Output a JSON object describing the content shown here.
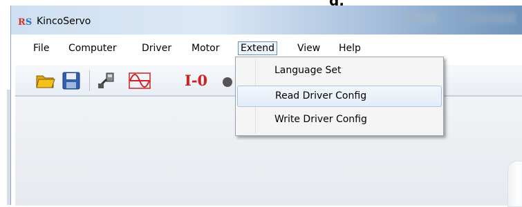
{
  "window": {
    "title": "KincoServo",
    "icon_letters": [
      "R",
      "S"
    ]
  },
  "menubar": {
    "items": [
      "File",
      "Computer",
      "Driver",
      "Motor",
      "Extend",
      "View",
      "Help"
    ],
    "active": "Extend"
  },
  "toolbar": {
    "buttons": [
      "open-folder-icon",
      "save-disk-icon",
      "connect-icon",
      "oscilloscope-icon",
      "io-icon",
      "settings-icon"
    ],
    "io_label": "I-0"
  },
  "extend_menu": {
    "items": [
      "Language Set",
      "Read Driver Config",
      "Write Driver Config"
    ],
    "hovered": "Read Driver Config"
  },
  "colors": {
    "menu_highlight_border": "#6b8fb3",
    "hover_fill": "#e3ecf7",
    "io_red": "#d21f1f",
    "folder_yellow": "#f3c21b",
    "disk_blue": "#2e5fb0"
  }
}
